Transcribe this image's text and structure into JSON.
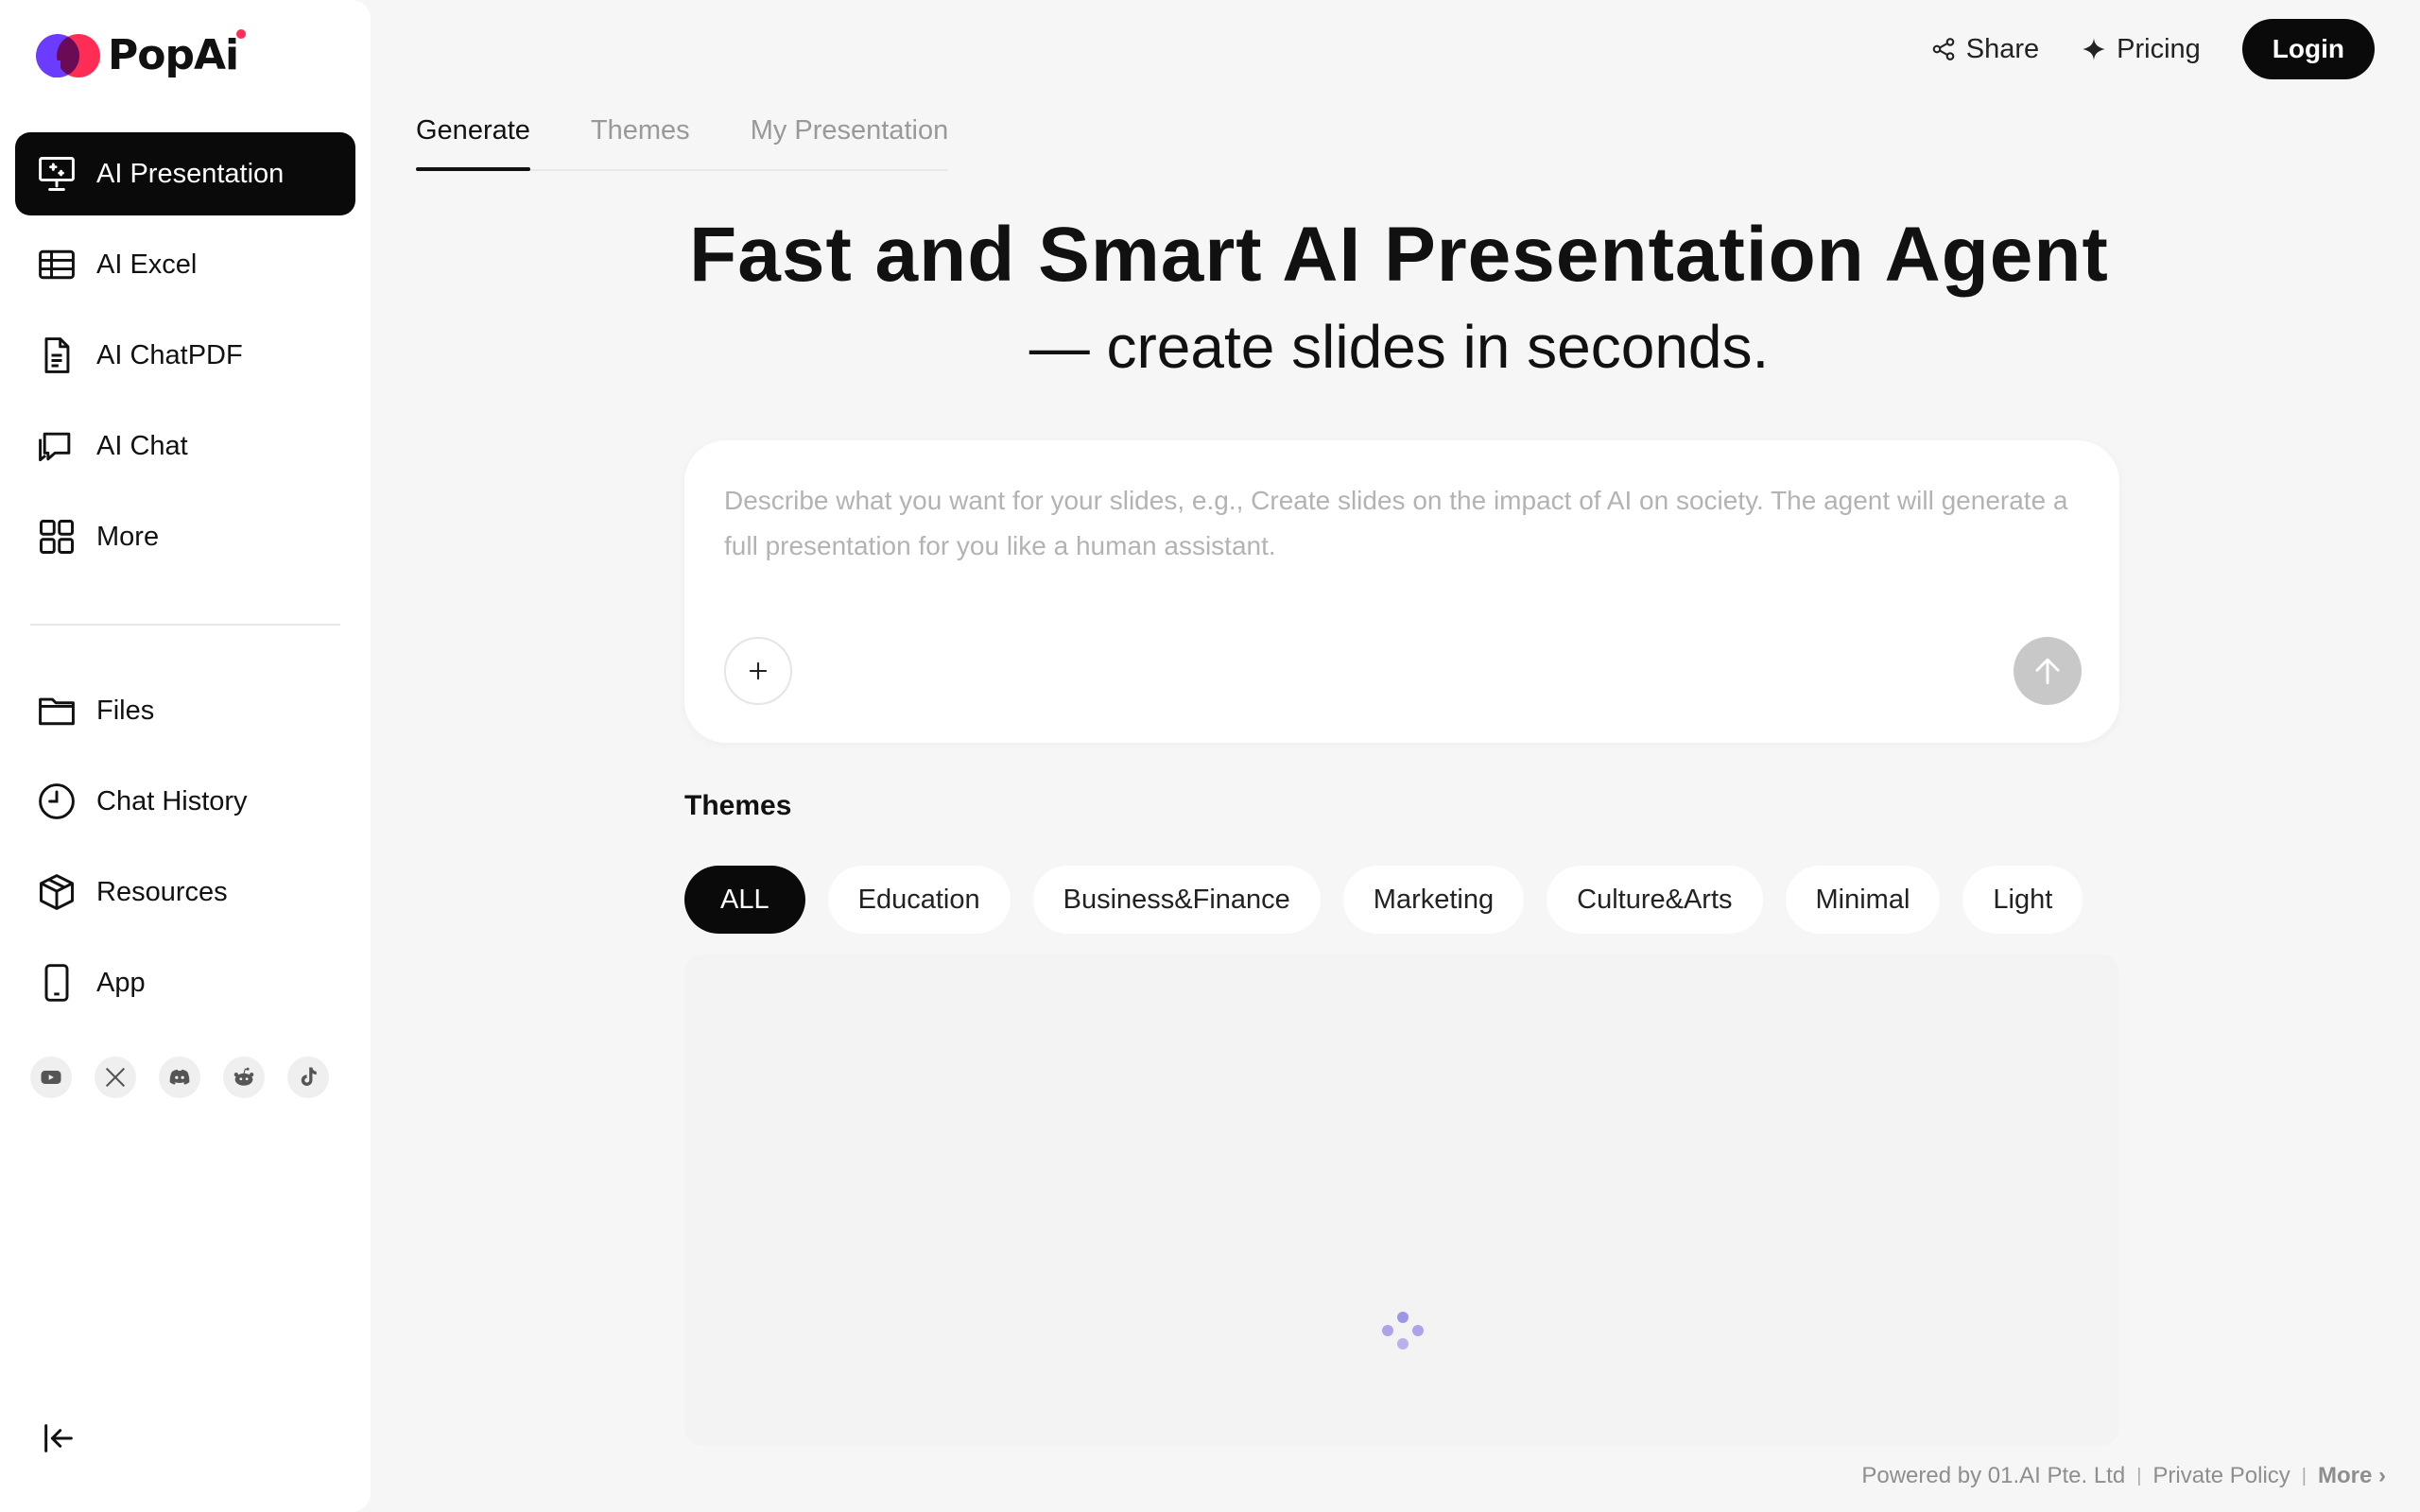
{
  "brand": {
    "name": "PopAi"
  },
  "sidebar": {
    "top_items": [
      {
        "label": "AI Presentation",
        "icon": "presentation-icon"
      },
      {
        "label": "AI Excel",
        "icon": "table-icon"
      },
      {
        "label": "AI ChatPDF",
        "icon": "document-icon"
      },
      {
        "label": "AI Chat",
        "icon": "chat-icon"
      },
      {
        "label": "More",
        "icon": "grid-icon"
      }
    ],
    "bottom_items": [
      {
        "label": "Files",
        "icon": "folder-icon"
      },
      {
        "label": "Chat History",
        "icon": "clock-icon"
      },
      {
        "label": "Resources",
        "icon": "box-icon"
      },
      {
        "label": "App",
        "icon": "phone-icon"
      }
    ],
    "socials": [
      "youtube-icon",
      "x-icon",
      "discord-icon",
      "reddit-icon",
      "tiktok-icon"
    ]
  },
  "header": {
    "share": "Share",
    "pricing": "Pricing",
    "login": "Login"
  },
  "tabs": [
    "Generate",
    "Themes",
    "My Presentation"
  ],
  "hero": {
    "title": "Fast and Smart AI Presentation Agent",
    "subtitle": "— create slides in seconds."
  },
  "prompt": {
    "placeholder": "Describe what you want for your slides, e.g., Create slides on the impact of AI on society. The agent will generate a full presentation for you like a human assistant."
  },
  "themes": {
    "title": "Themes",
    "chips": [
      "ALL",
      "Education",
      "Business&Finance",
      "Marketing",
      "Culture&Arts",
      "Minimal",
      "Light"
    ]
  },
  "footer": {
    "powered": "Powered by 01.AI Pte. Ltd",
    "policy": "Private Policy",
    "more": "More"
  },
  "colors": {
    "accent": "#0a0a0a",
    "background": "#f6f6f6",
    "spinner": "#9d95e8"
  }
}
